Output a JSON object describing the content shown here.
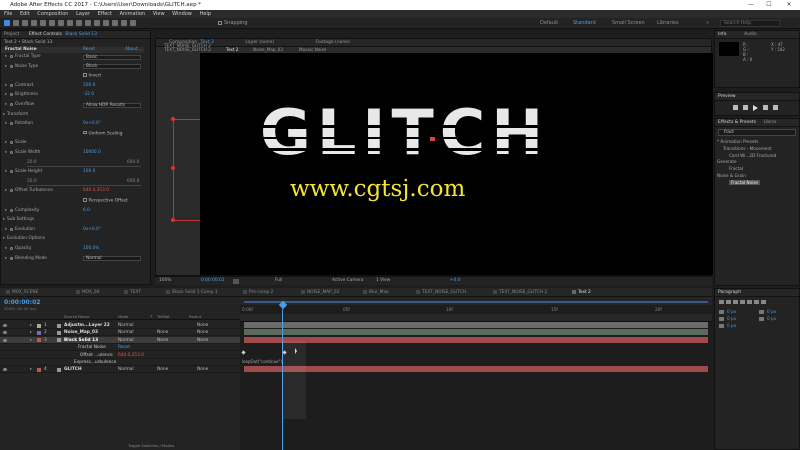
{
  "window": {
    "title": "Adobe After Effects CC 2017 - C:\\Users\\User\\Downloads\\GLITCH.aep *",
    "minimize": "—",
    "maximize": "☐",
    "close": "✕"
  },
  "menu": [
    "File",
    "Edit",
    "Composition",
    "Layer",
    "Effect",
    "Animation",
    "View",
    "Window",
    "Help"
  ],
  "toolbar": {
    "snapping": "Snapping",
    "workspaces": [
      "Default",
      "Standard",
      "Small Screen",
      "Libraries"
    ],
    "search_placeholder": "Search Help",
    "menu_icon": "»"
  },
  "effect_controls": {
    "tabs": [
      "Project",
      "Effect Controls",
      "Black Solid 13"
    ],
    "subtitle": "Text 2 • Black Solid 13",
    "effect_name": "Fractal Noise",
    "reset": "Reset",
    "about": "About...",
    "rows": [
      {
        "name": "Fractal Type",
        "value": "Basic",
        "kind": "dropdown"
      },
      {
        "name": "Noise Type",
        "value": "Block",
        "kind": "dropdown"
      },
      {
        "name": "",
        "value": "Invert",
        "kind": "checkbox"
      },
      {
        "name": "Contrast",
        "value": "200.0",
        "kind": "number"
      },
      {
        "name": "Brightness",
        "value": "-32.0",
        "kind": "number"
      },
      {
        "name": "Overflow",
        "value": "Allow HDR Results",
        "kind": "dropdown"
      },
      {
        "name": "Transform",
        "value": "",
        "kind": "group"
      },
      {
        "name": "Rotation",
        "value": "0x+0.0°",
        "kind": "number"
      },
      {
        "name": "",
        "value": "Uniform Scaling",
        "kind": "checkbox"
      },
      {
        "name": "Scale",
        "value": "",
        "kind": "dim"
      },
      {
        "name": "Scale Width",
        "value": "10000.0",
        "kind": "number"
      },
      {
        "name": "20.0",
        "value": "600.0",
        "kind": "range"
      },
      {
        "name": "Scale Height",
        "value": "100.0",
        "kind": "number"
      },
      {
        "name": "20.0",
        "value": "600.0",
        "kind": "range"
      },
      {
        "name": "Offset Turbulence",
        "value": "640.0,353.0",
        "kind": "red"
      },
      {
        "name": "",
        "value": "Perspective Offset",
        "kind": "checkbox"
      },
      {
        "name": "Complexity",
        "value": "6.0",
        "kind": "number"
      },
      {
        "name": "Sub Settings",
        "value": "",
        "kind": "group"
      },
      {
        "name": "Evolution",
        "value": "0x+0.0°",
        "kind": "number"
      },
      {
        "name": "Evolution Options",
        "value": "",
        "kind": "group"
      },
      {
        "name": "Opacity",
        "value": "100.0%",
        "kind": "number"
      },
      {
        "name": "Blending Mode",
        "value": "Normal",
        "kind": "dropdown"
      }
    ]
  },
  "viewer": {
    "tabs": [
      "Composition",
      "Text 2",
      "Layer (none)",
      "Footage (none)"
    ],
    "subtabs": [
      "TEXT_NOISE_GLITCH 2",
      "Text 2",
      "Noise_Map_03",
      "Mosaic Noise"
    ],
    "glitch_text": "GLITCH",
    "watermark": "www.cgtsj.com",
    "zoom": "100%",
    "timecode": "0:00:00:02",
    "resolution": "Full",
    "camera": "Active Camera",
    "views": "1 View",
    "exposure": "+0.0"
  },
  "timeline": {
    "tabs": [
      {
        "name": "MOX_SCENE",
        "color": "#8a8a8a"
      },
      {
        "name": "MOX_04",
        "color": "#8a8a8a"
      },
      {
        "name": "TEXT",
        "color": "#8a8a8a"
      },
      {
        "name": "Black Solid 1 Comp 1",
        "color": "#8a8a8a"
      },
      {
        "name": "Pre-comp 2",
        "color": "#8a8a8a"
      },
      {
        "name": "NOISE_MAP_02",
        "color": "#8a8a8a"
      },
      {
        "name": "Blur_Map",
        "color": "#8a8a8a"
      },
      {
        "name": "TEXT_NOISE_GLITCH",
        "color": "#8a8a8a"
      },
      {
        "name": "TEXT_NOISE_GLITCH 2",
        "color": "#8a8a8a"
      },
      {
        "name": "Text 2",
        "color": "#e0e0e0"
      }
    ],
    "timecode": "0:00:00:02",
    "timecode_sub": "00002 (30.00 fps)",
    "columns": [
      "Source Name",
      "Mode",
      "T",
      "TrkMat",
      "Parent"
    ],
    "layers": [
      {
        "num": "1",
        "name": "Adjustm...Layer 22",
        "mode": "Normal",
        "trkmat": "",
        "parent": "None",
        "color": "#a8a8a8",
        "bar": "#6b6b6b"
      },
      {
        "num": "2",
        "name": "Noise_Map_03",
        "mode": "Normal",
        "trkmat": "None",
        "parent": "None",
        "color": "#6f6fb8",
        "bar": "#5a6b5a"
      },
      {
        "num": "3",
        "name": "Black Solid 13",
        "mode": "Normal",
        "trkmat": "None",
        "parent": "None",
        "color": "#b85a5a",
        "bar": "#a04a4a"
      },
      {
        "num": "",
        "name": "Fractal Noise",
        "mode": "Reset",
        "trkmat": "",
        "parent": "",
        "color": "",
        "bar": ""
      },
      {
        "num": "",
        "name": "Offset ...ulence",
        "mode": "640.0,353.0",
        "trkmat": "",
        "parent": "",
        "color": "",
        "bar": ""
      },
      {
        "num": "",
        "name": "Express...urbulence",
        "mode": "",
        "trkmat": "",
        "parent": "",
        "color": "",
        "bar": ""
      },
      {
        "num": "4",
        "name": "GLITCH",
        "mode": "Normal",
        "trkmat": "None",
        "parent": "None",
        "color": "#b85a5a",
        "bar": "#a04a4a"
      }
    ],
    "expression": "loopOut(\"continue\")",
    "ruler": [
      "0:00f",
      "05f",
      "10f",
      "15f",
      "20f"
    ],
    "toggle": "Toggle Switches / Modes"
  },
  "info": {
    "tabs": [
      "Info",
      "Audio"
    ],
    "r": "R :",
    "g": "G :",
    "b": "B :",
    "a": "A : 0",
    "x": "X : 47",
    "y": "Y : 542"
  },
  "preview": {
    "title": "Preview"
  },
  "effects_presets": {
    "tabs": [
      "Effects & Presets",
      "Librar"
    ],
    "search": "fract",
    "tree": [
      "* Animation Presets",
      "Transitions - Movement",
      "Card Wi...2D Fractured",
      "Generate",
      "Fractal",
      "Noise & Grain",
      "Fractal Noise"
    ]
  },
  "paragraph": {
    "title": "Paragraph",
    "values": [
      "0 px",
      "0 px",
      "0 px",
      "0 px",
      "0 px"
    ]
  }
}
